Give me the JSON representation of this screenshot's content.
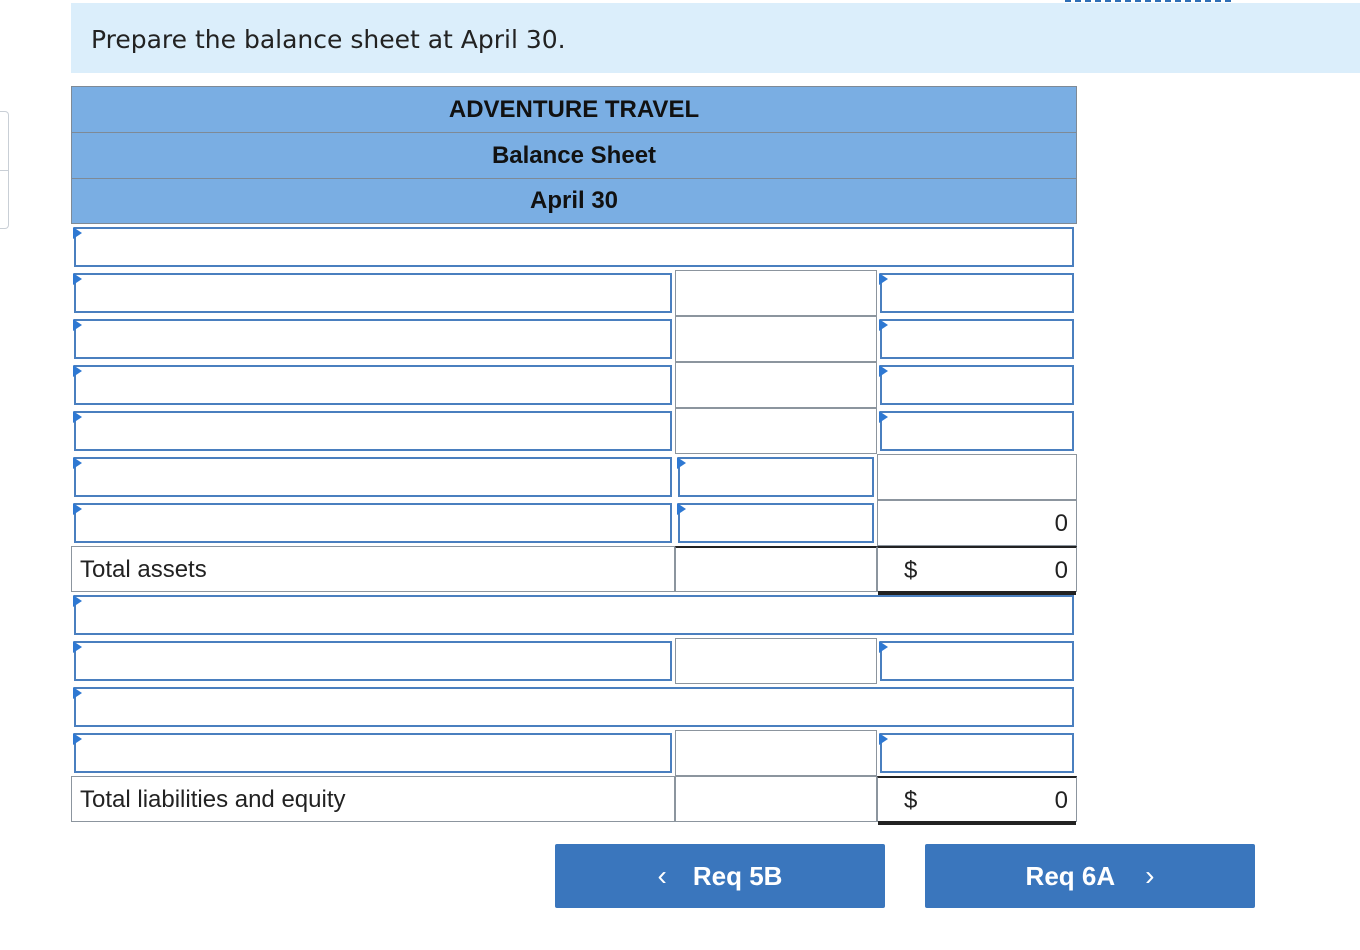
{
  "prompt": "Prepare the balance sheet at April 30.",
  "sheet": {
    "company": "ADVENTURE TRAVEL",
    "statement": "Balance Sheet",
    "date": "April 30"
  },
  "rows": {
    "assets_subtotal_value": "0",
    "total_assets": {
      "label": "Total assets",
      "currency": "$",
      "value": "0"
    },
    "total_liabilities_equity": {
      "label": "Total liabilities and equity",
      "currency": "$",
      "value": "0"
    }
  },
  "nav": {
    "prev_label": "Req 5B",
    "next_label": "Req 6A",
    "prev_icon": "chevron-left-icon",
    "next_icon": "chevron-right-icon"
  },
  "colors": {
    "header_blue": "#7aaee3",
    "prompt_band": "#dbeefb",
    "button_blue": "#3a76bd",
    "input_border": "#4a7fbf"
  }
}
